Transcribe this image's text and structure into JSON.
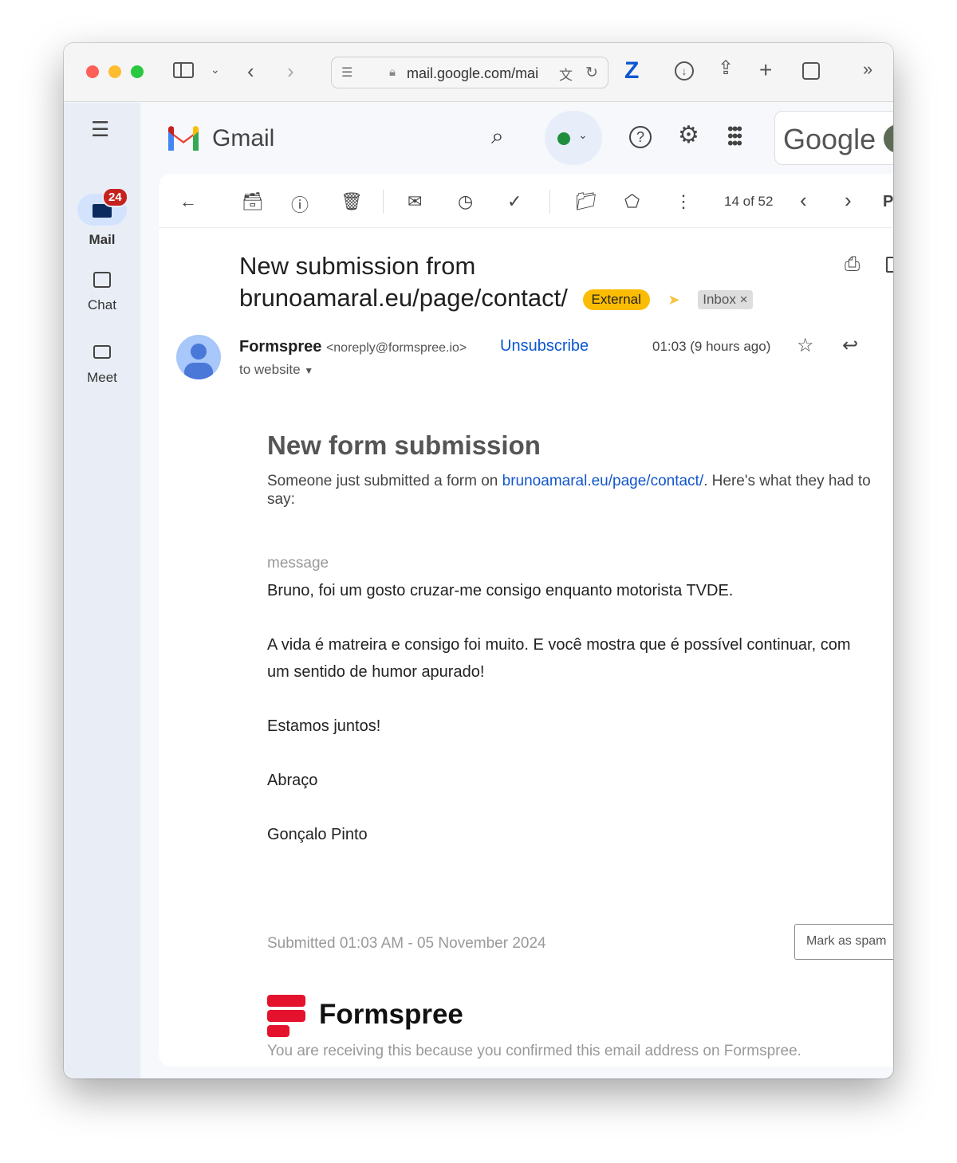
{
  "browser": {
    "url": "mail.google.com/mai",
    "extension_label": "Z"
  },
  "sidebar": {
    "mail_badge": "24",
    "items": [
      {
        "label": "Mail"
      },
      {
        "label": "Chat"
      },
      {
        "label": "Meet"
      }
    ]
  },
  "header": {
    "app_name": "Gmail",
    "google_label": "Google",
    "status_color": "#1e8e3e"
  },
  "toolbar": {
    "pagination": "14 of 52",
    "truncated": "P"
  },
  "email": {
    "subject_line1": "New submission from",
    "subject_line2": "brunoamaral.eu/page/contact/",
    "labels": [
      {
        "label": "External",
        "color": "#fbbc04"
      },
      {
        "label": "Inbox"
      }
    ],
    "sender_name": "Formspree",
    "sender_email": "<noreply@formspree.io>",
    "unsubscribe": "Unsubscribe",
    "time": "01:03 (9 hours ago)",
    "recipient": "to website",
    "body": {
      "heading": "New form submission",
      "intro_before": "Someone just submitted a form on ",
      "intro_link": "brunoamaral.eu/page/contact/",
      "intro_after": ". Here's what they had to say:",
      "field_label": "message",
      "paragraphs": [
        "Bruno, foi um gosto cruzar-me consigo enquanto motorista TVDE.",
        "A vida é matreira e consigo foi muito. E você mostra que é possível continuar, com um sentido de humor apurado!",
        "Estamos juntos!",
        "Abraço",
        "Gonçalo Pinto"
      ],
      "submitted": "Submitted 01:03 AM - 05 November 2024",
      "spam_button": "Mark as spam",
      "brand": "Formspree",
      "brand_color": "#e5122e",
      "footer": "You are receiving this because you confirmed this email address on Formspree."
    }
  }
}
